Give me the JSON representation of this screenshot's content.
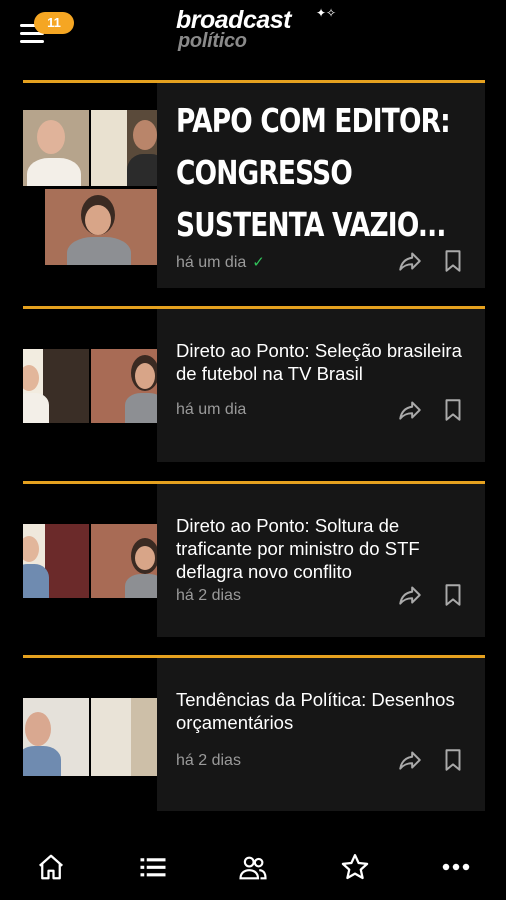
{
  "app": {
    "badge_count": "11",
    "logo_main": "broadcast",
    "logo_sub": "político"
  },
  "articles": [
    {
      "title": "PAPO COM EDITOR: CONGRESSO SUSTENTA VAZIO...",
      "time": "há um dia",
      "check": "✓"
    },
    {
      "title": "Direto ao Ponto: Seleção brasileira de futebol na TV Brasil",
      "time": "há um dia"
    },
    {
      "title": "Direto ao Ponto: Soltura de traficante por ministro do STF deflagra novo conflito",
      "time": "há 2 dias"
    },
    {
      "title": "Tendências da Política: Desenhos orçamentários",
      "time": "há 2 dias"
    }
  ],
  "colors": {
    "accent": "#e5a11f",
    "badge": "#f5a623",
    "check": "#31c25a",
    "card_bg": "#161616"
  },
  "bottom_nav": [
    "home-icon",
    "list-icon",
    "people-icon",
    "star-icon",
    "more-icon"
  ]
}
